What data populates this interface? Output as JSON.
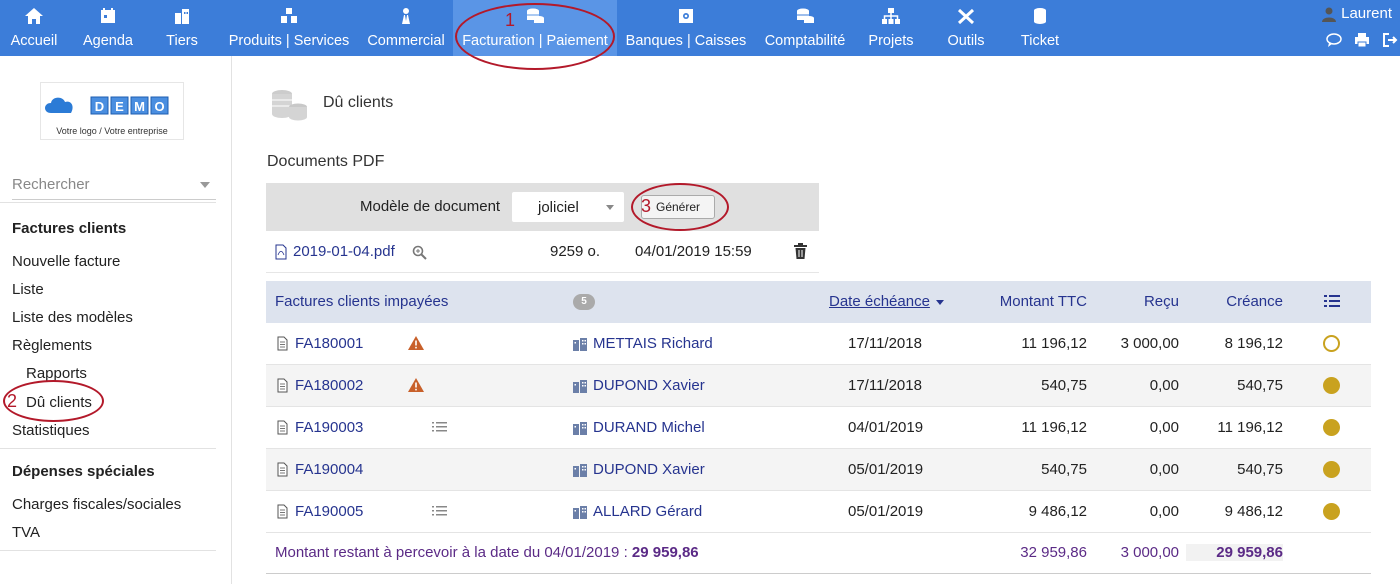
{
  "nav": {
    "items": [
      {
        "label": "Accueil",
        "icon": "home-icon"
      },
      {
        "label": "Agenda",
        "icon": "agenda-icon"
      },
      {
        "label": "Tiers",
        "icon": "building-icon"
      },
      {
        "label": "Produits | Services",
        "icon": "cubes-icon"
      },
      {
        "label": "Commercial",
        "icon": "suit-icon"
      },
      {
        "label": "Facturation | Paiement",
        "icon": "coins-icon"
      },
      {
        "label": "Banques | Caisses",
        "icon": "safe-icon"
      },
      {
        "label": "Comptabilité",
        "icon": "coins-icon"
      },
      {
        "label": "Projets",
        "icon": "sitemap-icon"
      },
      {
        "label": "Outils",
        "icon": "tools-icon"
      },
      {
        "label": "Ticket",
        "icon": "database-icon"
      }
    ],
    "user": "Laurent"
  },
  "sidebar": {
    "logo_text": "DEMO",
    "logo_caption": "Votre logo / Votre entreprise",
    "search_placeholder": "Rechercher",
    "section1": "Factures clients",
    "items1": [
      "Nouvelle facture",
      "Liste",
      "Liste des modèles",
      "Règlements",
      "Rapports",
      "Dû clients",
      "Statistiques"
    ],
    "section2": "Dépenses spéciales",
    "items2": [
      "Charges fiscales/sociales",
      "TVA"
    ]
  },
  "page": {
    "title": "Dû clients",
    "docs_title": "Documents PDF",
    "model_label": "Modèle de document",
    "model_value": "joliciel",
    "generate_label": "Générer",
    "file": {
      "name": "2019-01-04.pdf",
      "size": "9259 o.",
      "date": "04/01/2019 15:59"
    }
  },
  "table": {
    "headers": {
      "title": "Factures clients impayées",
      "count": "5",
      "due": "Date échéance",
      "ttc": "Montant TTC",
      "recu": "Reçu",
      "creance": "Créance"
    },
    "rows": [
      {
        "ref": "FA180001",
        "warn": true,
        "list": false,
        "client": "METTAIS Richard",
        "due": "17/11/2018",
        "ttc": "11 196,12",
        "recu": "3 000,00",
        "creance": "8 196,12",
        "status": "empty"
      },
      {
        "ref": "FA180002",
        "warn": true,
        "list": false,
        "client": "DUPOND Xavier",
        "due": "17/11/2018",
        "ttc": "540,75",
        "recu": "0,00",
        "creance": "540,75",
        "status": "filled"
      },
      {
        "ref": "FA190003",
        "warn": false,
        "list": true,
        "client": "DURAND Michel",
        "due": "04/01/2019",
        "ttc": "11 196,12",
        "recu": "0,00",
        "creance": "11 196,12",
        "status": "filled"
      },
      {
        "ref": "FA190004",
        "warn": false,
        "list": false,
        "client": "DUPOND Xavier",
        "due": "05/01/2019",
        "ttc": "540,75",
        "recu": "0,00",
        "creance": "540,75",
        "status": "filled"
      },
      {
        "ref": "FA190005",
        "warn": false,
        "list": true,
        "client": "ALLARD Gérard",
        "due": "05/01/2019",
        "ttc": "9 486,12",
        "recu": "0,00",
        "creance": "9 486,12",
        "status": "filled"
      }
    ],
    "footer": {
      "label": "Montant restant à percevoir à la date du 04/01/2019 :",
      "label_total": "29 959,86",
      "ttc": "32 959,86",
      "recu": "3 000,00",
      "creance": "29 959,86"
    }
  },
  "annotations": [
    "1",
    "2",
    "3"
  ],
  "colors": {
    "topbar": "#3c7dd9",
    "link": "#26348f",
    "status_dot": "#c9a21f",
    "annotation": "#b3192a"
  }
}
